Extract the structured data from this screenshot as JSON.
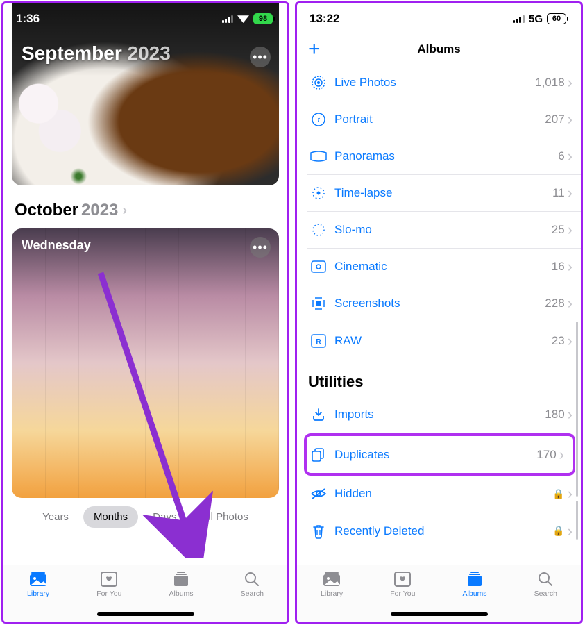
{
  "left": {
    "status": {
      "time": "1:36",
      "battery": "98"
    },
    "card1": {
      "month": "September",
      "year": "2023"
    },
    "monthHeader": {
      "month": "October",
      "year": "2023"
    },
    "card2": {
      "day": "Wednesday"
    },
    "segments": {
      "years": "Years",
      "months": "Months",
      "days": "Days",
      "all": "All Photos"
    },
    "tabs": {
      "library": "Library",
      "foryou": "For You",
      "albums": "Albums",
      "search": "Search"
    }
  },
  "right": {
    "status": {
      "time": "13:22",
      "net": "5G",
      "battery": "60"
    },
    "title": "Albums",
    "mediaTypes": [
      {
        "icon": "live",
        "name": "Live Photos",
        "count": "1,018"
      },
      {
        "icon": "portrait",
        "name": "Portrait",
        "count": "207"
      },
      {
        "icon": "pano",
        "name": "Panoramas",
        "count": "6"
      },
      {
        "icon": "timelapse",
        "name": "Time-lapse",
        "count": "11"
      },
      {
        "icon": "slomo",
        "name": "Slo-mo",
        "count": "25"
      },
      {
        "icon": "cinematic",
        "name": "Cinematic",
        "count": "16"
      },
      {
        "icon": "screenshot",
        "name": "Screenshots",
        "count": "228"
      },
      {
        "icon": "raw",
        "name": "RAW",
        "count": "23"
      }
    ],
    "utilitiesHeader": "Utilities",
    "utilities": [
      {
        "icon": "imports",
        "name": "Imports",
        "count": "180",
        "locked": false
      },
      {
        "icon": "dup",
        "name": "Duplicates",
        "count": "170",
        "locked": false,
        "hl": true
      },
      {
        "icon": "hidden",
        "name": "Hidden",
        "count": "",
        "locked": true
      },
      {
        "icon": "trash",
        "name": "Recently Deleted",
        "count": "",
        "locked": true
      }
    ],
    "tabs": {
      "library": "Library",
      "foryou": "For You",
      "albums": "Albums",
      "search": "Search"
    }
  }
}
